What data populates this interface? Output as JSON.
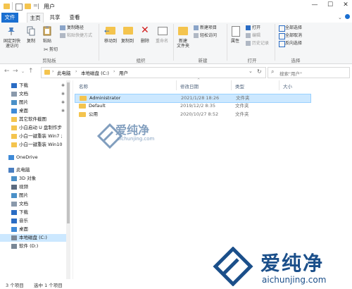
{
  "window": {
    "title": "用户",
    "path_sep": "=",
    "buttons": {
      "minimize": "—",
      "maximize": "☐",
      "close": "✕"
    }
  },
  "ribbon_tabs": [
    "文件",
    "主页",
    "共享",
    "查看"
  ],
  "ribbon": {
    "clipboard": {
      "pin_label_1": "固定到快",
      "pin_label_2": "速访问",
      "copy": "复制",
      "paste": "粘贴",
      "copy_path": "复制路径",
      "paste_shortcut": "粘贴快捷方式",
      "cut": "剪切",
      "group": "剪贴板"
    },
    "organize": {
      "move_to": "移动到",
      "copy_to": "复制到",
      "delete": "删除",
      "rename": "重命名",
      "group": "组织"
    },
    "new": {
      "new_folder_1": "新建",
      "new_folder_2": "文件夹",
      "new_item": "新建项目",
      "easy_access": "轻松访问",
      "group": "新建"
    },
    "open": {
      "properties": "属性",
      "open": "打开",
      "edit": "编辑",
      "history": "历史记录",
      "group": "打开"
    },
    "select": {
      "select_all": "全部选择",
      "select_none": "全部取消",
      "invert": "反向选择",
      "group": "选择"
    }
  },
  "address": {
    "crumbs": [
      "此电脑",
      "本地磁盘 (C:)",
      "用户"
    ],
    "search_placeholder": "搜索\"用户\""
  },
  "nav_pane": {
    "quick": [
      {
        "label": "下载",
        "pinned": true,
        "icon": "download-icon"
      },
      {
        "label": "文档",
        "pinned": true,
        "icon": "document-icon"
      },
      {
        "label": "图片",
        "pinned": true,
        "icon": "picture-icon"
      },
      {
        "label": "桌面",
        "pinned": true,
        "icon": "desktop-icon"
      },
      {
        "label": "其它软件截图",
        "pinned": false,
        "icon": "folder-icon"
      },
      {
        "label": "小白启动 U 盘制作步",
        "pinned": false,
        "icon": "folder-icon"
      },
      {
        "label": "小白一键重装 Win7 ;",
        "pinned": false,
        "icon": "folder-icon"
      },
      {
        "label": "小白一键重装 Win10",
        "pinned": false,
        "icon": "folder-icon"
      }
    ],
    "onedrive": "OneDrive",
    "this_pc": "此电脑",
    "pc_items": [
      {
        "label": "3D 对象",
        "icon": "3d-objects-icon"
      },
      {
        "label": "视频",
        "icon": "video-icon"
      },
      {
        "label": "图片",
        "icon": "picture-icon"
      },
      {
        "label": "文档",
        "icon": "document-icon"
      },
      {
        "label": "下载",
        "icon": "download-icon"
      },
      {
        "label": "音乐",
        "icon": "music-icon"
      },
      {
        "label": "桌面",
        "icon": "desktop-icon"
      },
      {
        "label": "本地磁盘 (C:)",
        "icon": "drive-icon",
        "selected": true
      },
      {
        "label": "软件 (D:)",
        "icon": "drive-icon"
      }
    ]
  },
  "columns": {
    "name": "名称",
    "date": "修改日期",
    "type": "类型",
    "size": "大小"
  },
  "files": [
    {
      "name": "Administrator",
      "date": "2021/1/28 18:26",
      "type": "文件夹",
      "selected": true
    },
    {
      "name": "Default",
      "date": "2019/12/2 8:35",
      "type": "文件夹",
      "selected": false
    },
    {
      "name": "公用",
      "date": "2020/10/27 8:52",
      "type": "文件夹",
      "selected": false
    }
  ],
  "status": {
    "count": "3 个项目",
    "selection": "选中 1 个项目"
  },
  "watermark": {
    "brand": "爱纯净",
    "url": "aichunjing.com"
  }
}
